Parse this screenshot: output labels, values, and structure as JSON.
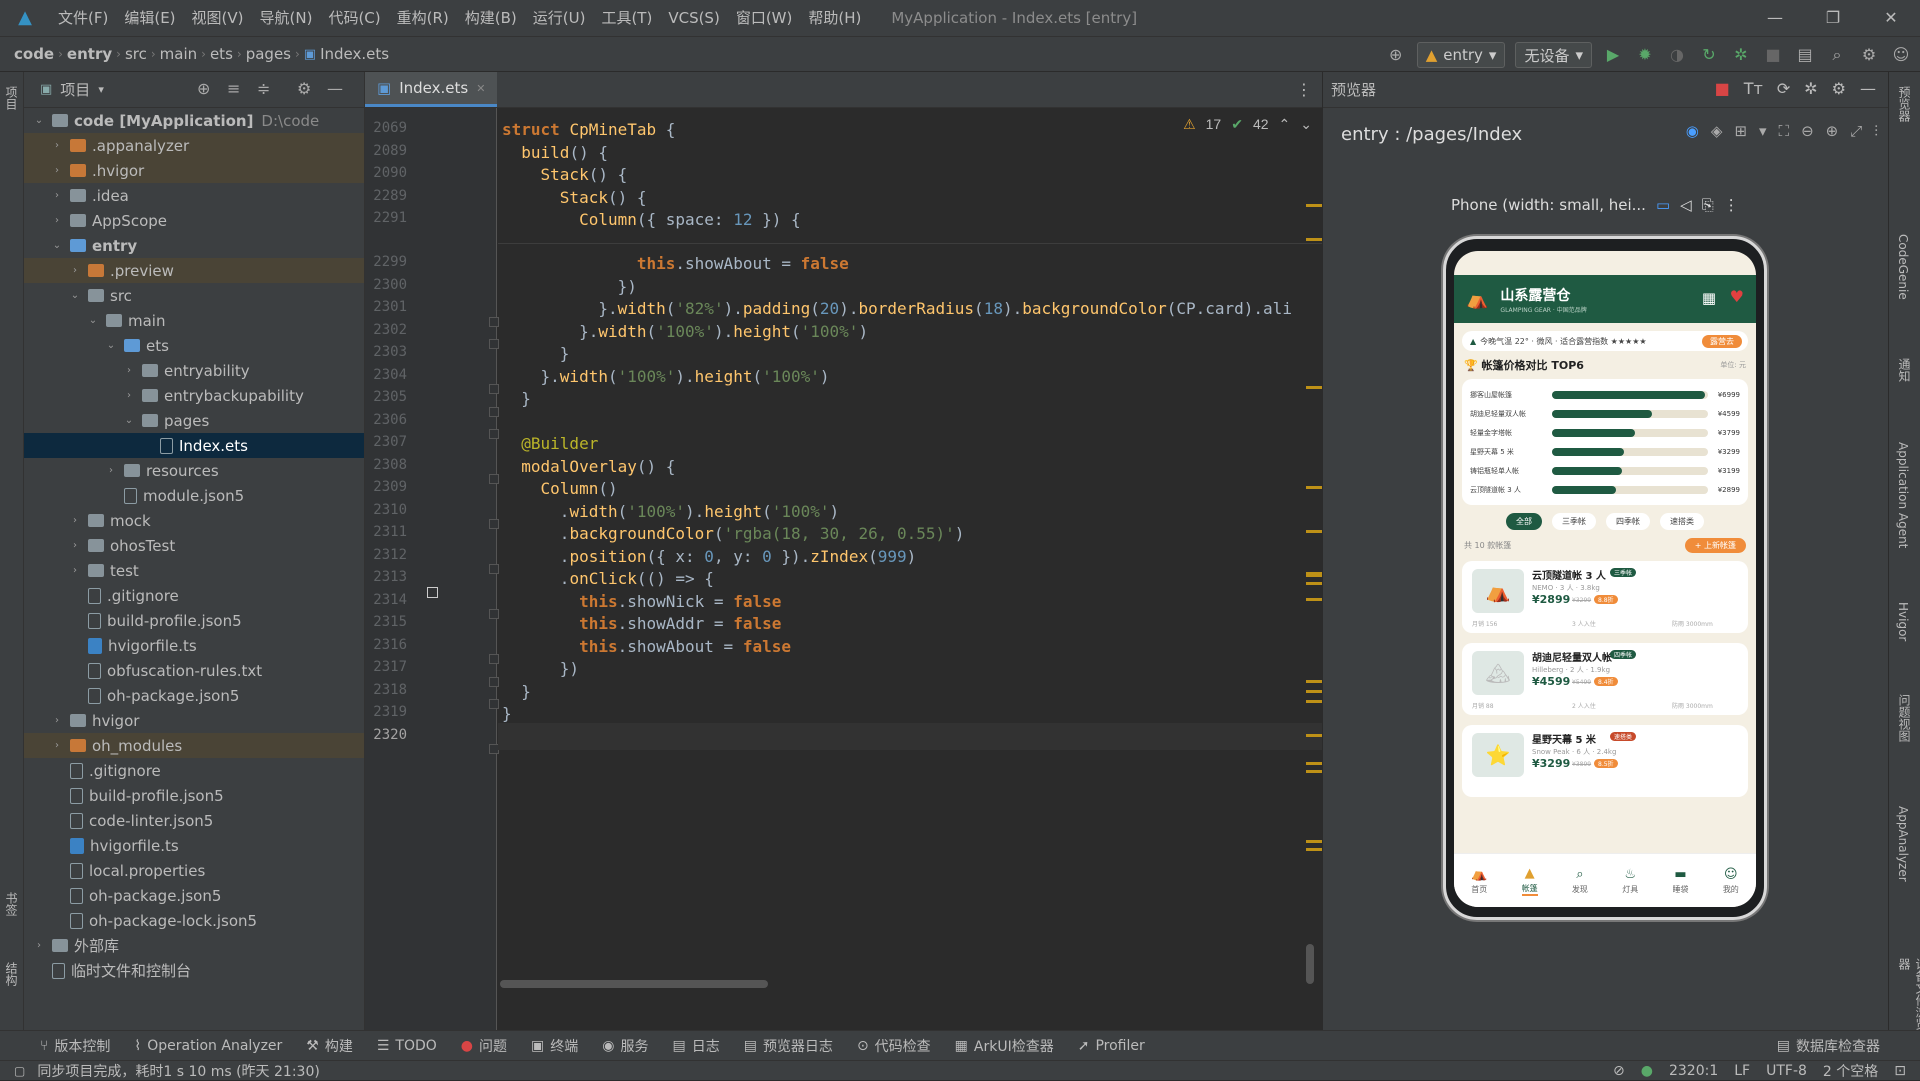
{
  "titlebar": {
    "menus": [
      "文件(F)",
      "编辑(E)",
      "视图(V)",
      "导航(N)",
      "代码(C)",
      "重构(R)",
      "构建(B)",
      "运行(U)",
      "工具(T)",
      "VCS(S)",
      "窗口(W)",
      "帮助(H)"
    ],
    "window_title": "MyApplication - Index.ets [entry]",
    "minimize": "—",
    "maximize": "❐",
    "close": "✕"
  },
  "navbar": {
    "breadcrumb": [
      "code",
      "entry",
      "src",
      "main",
      "ets",
      "pages",
      "Index.ets"
    ],
    "module": "entry",
    "device": "无设备"
  },
  "project": {
    "title": "项目",
    "tree": [
      {
        "label": "code [MyApplication]",
        "extra": "D:\\code",
        "open": true,
        "icon": "fold",
        "bold": true
      },
      {
        "label": ".appanalyzer",
        "icon": "orange",
        "arrow": "›",
        "hl": true
      },
      {
        "label": ".hvigor",
        "icon": "orange",
        "arrow": "›",
        "hl": true
      },
      {
        "label": ".idea",
        "icon": "fold",
        "arrow": "›"
      },
      {
        "label": "AppScope",
        "icon": "fold",
        "arrow": "›"
      },
      {
        "label": "entry",
        "icon": "blue",
        "arrow": "⌄",
        "bold": true
      },
      {
        "label": ".preview",
        "icon": "orange",
        "arrow": "›",
        "hl": true
      },
      {
        "label": "src",
        "icon": "fold",
        "arrow": "⌄"
      },
      {
        "label": "main",
        "icon": "fold",
        "arrow": "⌄"
      },
      {
        "label": "ets",
        "icon": "blue",
        "arrow": "⌄"
      },
      {
        "label": "entryability",
        "icon": "fold",
        "arrow": "›"
      },
      {
        "label": "entrybackupability",
        "icon": "fold",
        "arrow": "›"
      },
      {
        "label": "pages",
        "icon": "fold",
        "arrow": "⌄"
      },
      {
        "label": "Index.ets",
        "icon": "file",
        "sel": true
      },
      {
        "label": "resources",
        "icon": "fold",
        "arrow": "›"
      },
      {
        "label": "module.json5",
        "icon": "file"
      },
      {
        "label": "mock",
        "icon": "fold",
        "arrow": "›"
      },
      {
        "label": "ohosTest",
        "icon": "fold",
        "arrow": "›"
      },
      {
        "label": "test",
        "icon": "fold",
        "arrow": "›"
      },
      {
        "label": ".gitignore",
        "icon": "file"
      },
      {
        "label": "build-profile.json5",
        "icon": "file"
      },
      {
        "label": "hvigorfile.ts",
        "icon": "ts"
      },
      {
        "label": "obfuscation-rules.txt",
        "icon": "file"
      },
      {
        "label": "oh-package.json5",
        "icon": "file"
      },
      {
        "label": "hvigor",
        "icon": "fold",
        "arrow": "›"
      },
      {
        "label": "oh_modules",
        "icon": "orange",
        "arrow": "›",
        "hl": true
      },
      {
        "label": ".gitignore",
        "icon": "file"
      },
      {
        "label": "build-profile.json5",
        "icon": "file"
      },
      {
        "label": "code-linter.json5",
        "icon": "file"
      },
      {
        "label": "hvigorfile.ts",
        "icon": "ts"
      },
      {
        "label": "local.properties",
        "icon": "file"
      },
      {
        "label": "oh-package.json5",
        "icon": "file"
      },
      {
        "label": "oh-package-lock.json5",
        "icon": "file"
      },
      {
        "label": "外部库",
        "icon": "fold",
        "arrow": "›"
      },
      {
        "label": "临时文件和控制台",
        "icon": "file"
      }
    ]
  },
  "editor": {
    "tab": "Index.ets",
    "warnings": "17",
    "checks": "42",
    "lines": [
      {
        "n": "2069",
        "code": [
          [
            "kw",
            "struct "
          ],
          [
            "fn",
            "CpMineTab"
          ],
          [
            "pl",
            " {"
          ]
        ]
      },
      {
        "n": "2089",
        "code": [
          [
            "pl",
            "  "
          ],
          [
            "fn",
            "build"
          ],
          [
            "pl",
            "() {"
          ]
        ]
      },
      {
        "n": "2090",
        "code": [
          [
            "pl",
            "    "
          ],
          [
            "fn",
            "Stack"
          ],
          [
            "pl",
            "() {"
          ]
        ]
      },
      {
        "n": "2289",
        "code": [
          [
            "pl",
            "      "
          ],
          [
            "fn",
            "Stack"
          ],
          [
            "pl",
            "() {"
          ]
        ]
      },
      {
        "n": "2291",
        "code": [
          [
            "pl",
            "        "
          ],
          [
            "fn",
            "Column"
          ],
          [
            "pl",
            "({ space: "
          ],
          [
            "nm",
            "12"
          ],
          [
            "pl",
            " }) {"
          ]
        ]
      },
      {
        "n": "2299",
        "code": [
          [
            "pl",
            "              "
          ],
          [
            "kw",
            "this"
          ],
          [
            "pl",
            ".showAbout = "
          ],
          [
            "kw",
            "false"
          ]
        ]
      },
      {
        "n": "2300",
        "code": [
          [
            "pl",
            "            })"
          ]
        ]
      },
      {
        "n": "2301",
        "code": [
          [
            "pl",
            "          }."
          ],
          [
            "fn",
            "width"
          ],
          [
            "pl",
            "("
          ],
          [
            "st",
            "'82%'"
          ],
          [
            "pl",
            ")."
          ],
          [
            "fn",
            "padding"
          ],
          [
            "pl",
            "("
          ],
          [
            "nm",
            "20"
          ],
          [
            "pl",
            ")."
          ],
          [
            "fn",
            "borderRadius"
          ],
          [
            "pl",
            "("
          ],
          [
            "nm",
            "18"
          ],
          [
            "pl",
            ")."
          ],
          [
            "fn",
            "backgroundColor"
          ],
          [
            "pl",
            "(CP.card).ali"
          ]
        ]
      },
      {
        "n": "2302",
        "code": [
          [
            "pl",
            "        }."
          ],
          [
            "fn",
            "width"
          ],
          [
            "pl",
            "("
          ],
          [
            "st",
            "'100%'"
          ],
          [
            "pl",
            ")."
          ],
          [
            "fn",
            "height"
          ],
          [
            "pl",
            "("
          ],
          [
            "st",
            "'100%'"
          ],
          [
            "pl",
            ")"
          ]
        ]
      },
      {
        "n": "2303",
        "code": [
          [
            "pl",
            "      }"
          ]
        ]
      },
      {
        "n": "2304",
        "code": [
          [
            "pl",
            "    }."
          ],
          [
            "fn",
            "width"
          ],
          [
            "pl",
            "("
          ],
          [
            "st",
            "'100%'"
          ],
          [
            "pl",
            ")."
          ],
          [
            "fn",
            "height"
          ],
          [
            "pl",
            "("
          ],
          [
            "st",
            "'100%'"
          ],
          [
            "pl",
            ")"
          ]
        ]
      },
      {
        "n": "2305",
        "code": [
          [
            "pl",
            "  }"
          ]
        ]
      },
      {
        "n": "2306",
        "code": [
          [
            "pl",
            ""
          ]
        ]
      },
      {
        "n": "2307",
        "code": [
          [
            "pl",
            "  "
          ],
          [
            "at",
            "@Builder"
          ]
        ]
      },
      {
        "n": "2308",
        "code": [
          [
            "pl",
            "  "
          ],
          [
            "fn",
            "modalOverlay"
          ],
          [
            "pl",
            "() {"
          ]
        ]
      },
      {
        "n": "2309",
        "code": [
          [
            "pl",
            "    "
          ],
          [
            "fn",
            "Column"
          ],
          [
            "pl",
            "()"
          ]
        ]
      },
      {
        "n": "2310",
        "code": [
          [
            "pl",
            "      ."
          ],
          [
            "fn",
            "width"
          ],
          [
            "pl",
            "("
          ],
          [
            "st",
            "'100%'"
          ],
          [
            "pl",
            ")."
          ],
          [
            "fn",
            "height"
          ],
          [
            "pl",
            "("
          ],
          [
            "st",
            "'100%'"
          ],
          [
            "pl",
            ")"
          ]
        ]
      },
      {
        "n": "2311",
        "code": [
          [
            "pl",
            "      ."
          ],
          [
            "fn",
            "backgroundColor"
          ],
          [
            "pl",
            "("
          ],
          [
            "st",
            "'rgba(18, 30, 26, 0.55)'"
          ],
          [
            "pl",
            ")"
          ]
        ]
      },
      {
        "n": "2312",
        "code": [
          [
            "pl",
            "      ."
          ],
          [
            "fn",
            "position"
          ],
          [
            "pl",
            "({ x: "
          ],
          [
            "nm",
            "0"
          ],
          [
            "pl",
            ", y: "
          ],
          [
            "nm",
            "0"
          ],
          [
            "pl",
            " })."
          ],
          [
            "fn",
            "zIndex"
          ],
          [
            "pl",
            "("
          ],
          [
            "nm",
            "999"
          ],
          [
            "pl",
            ")"
          ]
        ]
      },
      {
        "n": "2313",
        "code": [
          [
            "pl",
            "      ."
          ],
          [
            "fn",
            "onClick"
          ],
          [
            "pl",
            "(() => {"
          ]
        ]
      },
      {
        "n": "2314",
        "code": [
          [
            "pl",
            "        "
          ],
          [
            "kw",
            "this"
          ],
          [
            "pl",
            ".showNick = "
          ],
          [
            "kw",
            "false"
          ]
        ]
      },
      {
        "n": "2315",
        "code": [
          [
            "pl",
            "        "
          ],
          [
            "kw",
            "this"
          ],
          [
            "pl",
            ".showAddr = "
          ],
          [
            "kw",
            "false"
          ]
        ]
      },
      {
        "n": "2316",
        "code": [
          [
            "pl",
            "        "
          ],
          [
            "kw",
            "this"
          ],
          [
            "pl",
            ".showAbout = "
          ],
          [
            "kw",
            "false"
          ]
        ]
      },
      {
        "n": "2317",
        "code": [
          [
            "pl",
            "      })"
          ]
        ]
      },
      {
        "n": "2318",
        "code": [
          [
            "pl",
            "  }"
          ]
        ]
      },
      {
        "n": "2319",
        "code": [
          [
            "pl",
            "}"
          ]
        ]
      },
      {
        "n": "2320",
        "code": [
          [
            "pl",
            ""
          ]
        ]
      }
    ]
  },
  "preview": {
    "title": "预览器",
    "route": "entry : /pages/Index",
    "device_label": "Phone (width: small, hei...",
    "app": {
      "name": "山系露营仓",
      "subtitle": "GLAMPING GEAR · 中国范品牌",
      "weather": "今晚气温 22° · 微风 · 适合露营指数 ★★★★★",
      "weather_btn": "露营去",
      "compare_title": "帐篷价格对比 TOP6",
      "unit": "单位: 元",
      "rows": [
        {
          "name": "挪客山屋帐篷",
          "price": "¥6999",
          "pct": 0.98
        },
        {
          "name": "胡迪尼轻量双人帐",
          "price": "¥4599",
          "pct": 0.64
        },
        {
          "name": "轻量金字塔帐",
          "price": "¥3799",
          "pct": 0.53
        },
        {
          "name": "星野天幕 5 米",
          "price": "¥3299",
          "pct": 0.46
        },
        {
          "name": "铸铝瓶轻单人帐",
          "price": "¥3199",
          "pct": 0.45
        },
        {
          "name": "云顶隧道帐 3 人",
          "price": "¥2899",
          "pct": 0.41
        }
      ],
      "filters": [
        "全部",
        "三季帐",
        "四季帐",
        "速搭类"
      ],
      "count": "共 10 款帐篷",
      "add_btn": "+ 上新帐篷",
      "products": [
        {
          "name": "云顶隧道帐 3 人",
          "tag": "三季帐",
          "meta": "NEMO · 3 人 · 3.8kg",
          "price": "¥2899",
          "old": "¥3299",
          "disc": "8.8折",
          "sold": "月销 156",
          "cap": "3 人入住",
          "height": "防雨 3000mm",
          "icon": "⛺"
        },
        {
          "name": "胡迪尼轻量双人帐",
          "tag": "四季帐",
          "meta": "Hilleberg · 2 人 · 1.9kg",
          "price": "¥4599",
          "old": "¥5499",
          "disc": "8.4折",
          "sold": "月销 88",
          "cap": "2 人入住",
          "height": "防雨 3000mm",
          "icon": "🏔"
        },
        {
          "name": "星野天幕 5 米",
          "tag": "速搭类",
          "meta": "Snow Peak · 6 人 · 2.4kg",
          "price": "¥3299",
          "old": "¥3899",
          "disc": "8.5折",
          "sold": "",
          "cap": "",
          "height": "",
          "icon": "⭐"
        }
      ],
      "nav": [
        "首页",
        "帐篷",
        "发现",
        "灯具",
        "睡袋",
        "我的"
      ]
    }
  },
  "bottom_tools": [
    "版本控制",
    "Operation Analyzer",
    "构建",
    "TODO",
    "问题",
    "终端",
    "服务",
    "日志",
    "预览器日志",
    "代码检查",
    "ArkUI检查器",
    "Profiler",
    "数据库检查器"
  ],
  "status": {
    "message": "同步项目完成，耗时1 s 10 ms (昨天 21:30)",
    "position": "2320:1",
    "line_sep": "LF",
    "encoding": "UTF-8",
    "indent": "2 个空格"
  },
  "left_strip": [
    "项目",
    "书签",
    "结构"
  ],
  "right_strip": [
    "预览器",
    "CodeGenie",
    "通知",
    "Application Agent",
    "Hvigor",
    "问题视图",
    "AppAnalyzer",
    "设备文件浏览器"
  ]
}
